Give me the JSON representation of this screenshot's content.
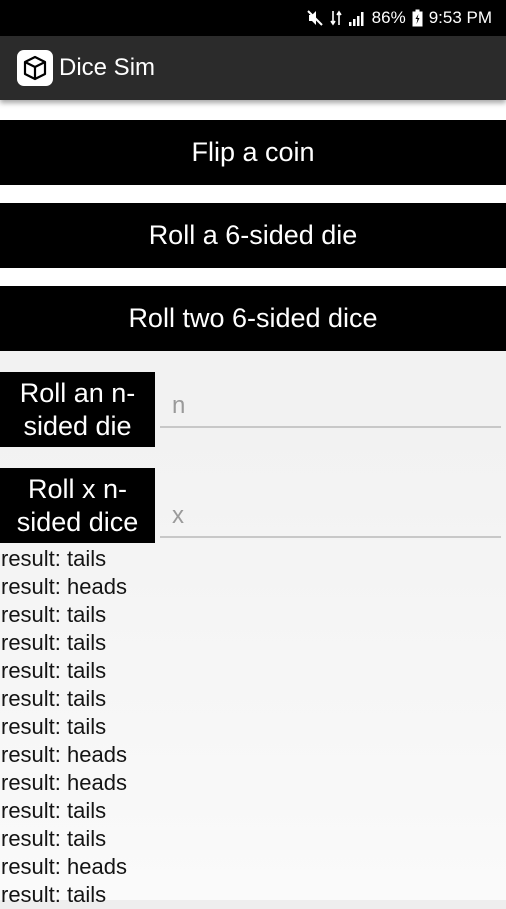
{
  "status_bar": {
    "battery": "86%",
    "time": "9:53 PM",
    "icons": [
      "mute-icon",
      "data-icon",
      "signal-icon",
      "battery-icon"
    ]
  },
  "app_bar": {
    "title": "Dice Sim",
    "logo_icon": "cube-icon"
  },
  "buttons": {
    "flip_coin": "Flip a coin",
    "roll_d6": "Roll a 6-sided die",
    "roll_2d6": "Roll two 6-sided dice",
    "roll_n": "Roll an n-sided die",
    "roll_xn": "Roll x n-sided dice"
  },
  "inputs": {
    "n": {
      "placeholder": "n",
      "value": ""
    },
    "x": {
      "placeholder": "x",
      "value": ""
    }
  },
  "results": [
    "result: tails",
    "result: heads",
    "result: tails",
    "result: tails",
    "result: tails",
    "result: tails",
    "result: tails",
    "result: heads",
    "result: heads",
    "result: tails",
    "result: tails",
    "result: heads",
    "result: tails"
  ],
  "colors": {
    "button_bg": "#000000",
    "app_bar_bg": "#2b2b2b",
    "status_bar_bg": "#000000"
  }
}
